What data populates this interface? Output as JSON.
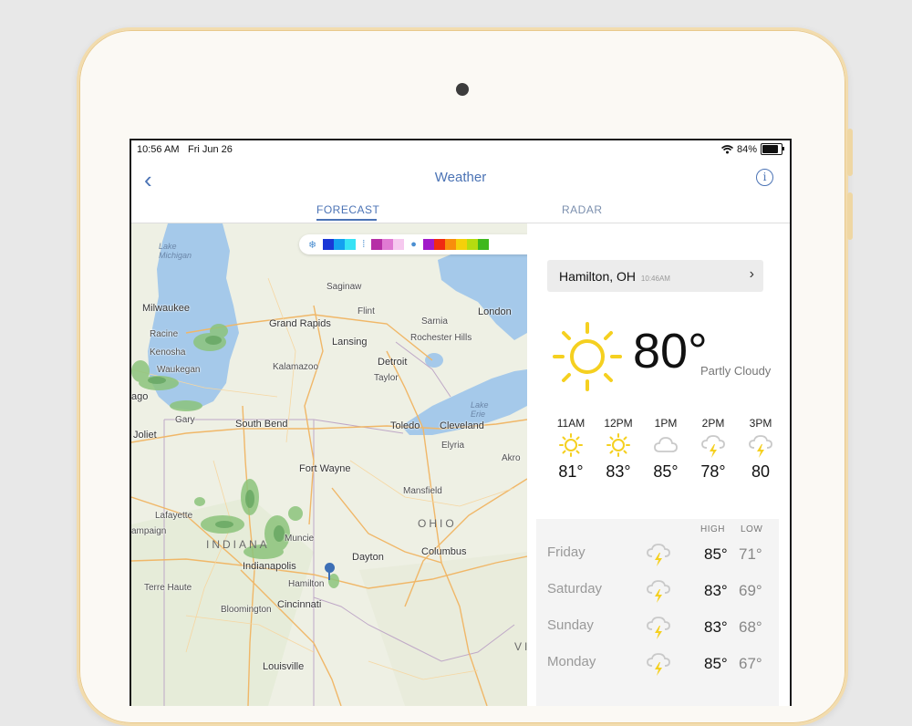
{
  "status": {
    "time": "10:56 AM",
    "date": "Fri Jun 26",
    "battery": "84%"
  },
  "nav": {
    "title": "Weather",
    "back": "‹",
    "info": "i"
  },
  "tabs": [
    {
      "label": "FORECAST",
      "active": true
    },
    {
      "label": "RADAR",
      "active": false
    }
  ],
  "legend": {
    "snow_colors": [
      "#1a37d6",
      "#14a0f0",
      "#37e2f5"
    ],
    "mix_colors": [
      "#b62fa6",
      "#e07ad3",
      "#f6c9ef"
    ],
    "rain_colors": [
      "#a119c9",
      "#f02a12",
      "#f88e0c",
      "#f5d00a",
      "#b5dc10",
      "#3fb81d"
    ]
  },
  "map": {
    "lakes": {
      "michigan": "Lake\nMichigan",
      "erie": "Lake\nErie"
    },
    "regions": {
      "indiana": "INDIANA",
      "ohio": "OHIO",
      "vi": "VI"
    },
    "cities": {
      "milwaukee": "Milwaukee",
      "racine": "Racine",
      "kenosha": "Kenosha",
      "waukegan": "Waukegan",
      "chicago": "ago",
      "gary": "Gary",
      "joliet": "Joliet",
      "south_bend": "South Bend",
      "grand_rapids": "Grand Rapids",
      "lansing": "Lansing",
      "kalamazoo": "Kalamazoo",
      "saginaw": "Saginaw",
      "flint": "Flint",
      "sarnia": "Sarnia",
      "london": "London",
      "rochester_hills": "Rochester Hills",
      "detroit": "Detroit",
      "taylor": "Taylor",
      "toledo": "Toledo",
      "cleveland": "Cleveland",
      "elyria": "Elyria",
      "akron": "Akro",
      "fort_wayne": "Fort Wayne",
      "mansfield": "Mansfield",
      "lafayette": "Lafayette",
      "champaign": "ampaign",
      "muncie": "Muncie",
      "dayton": "Dayton",
      "columbus": "Columbus",
      "indianapolis": "Indianapolis",
      "hamilton": "Hamilton",
      "terre_haute": "Terre Haute",
      "bloomington": "Bloomington",
      "cincinnati": "Cincinnati",
      "louisville": "Louisville"
    }
  },
  "location": {
    "name": "Hamilton, OH",
    "time": "10:46AM"
  },
  "current": {
    "temp": "80°",
    "desc": "Partly Cloudy",
    "icon": "sun-icon"
  },
  "hourly": [
    {
      "label": "11AM",
      "icon": "sun-icon",
      "temp": "81°"
    },
    {
      "label": "12PM",
      "icon": "sun-icon",
      "temp": "83°"
    },
    {
      "label": "1PM",
      "icon": "cloud-icon",
      "temp": "85°"
    },
    {
      "label": "2PM",
      "icon": "thunderstorm-icon",
      "temp": "78°"
    },
    {
      "label": "3PM",
      "icon": "thunderstorm-icon",
      "temp": "80"
    }
  ],
  "daily_headers": {
    "high": "HIGH",
    "low": "LOW"
  },
  "daily": [
    {
      "day": "Friday",
      "icon": "thunderstorm-icon",
      "high": "85°",
      "low": "71°"
    },
    {
      "day": "Saturday",
      "icon": "thunderstorm-icon",
      "high": "83°",
      "low": "69°"
    },
    {
      "day": "Sunday",
      "icon": "thunderstorm-icon",
      "high": "83°",
      "low": "68°"
    },
    {
      "day": "Monday",
      "icon": "thunderstorm-icon",
      "high": "85°",
      "low": "67°"
    }
  ]
}
